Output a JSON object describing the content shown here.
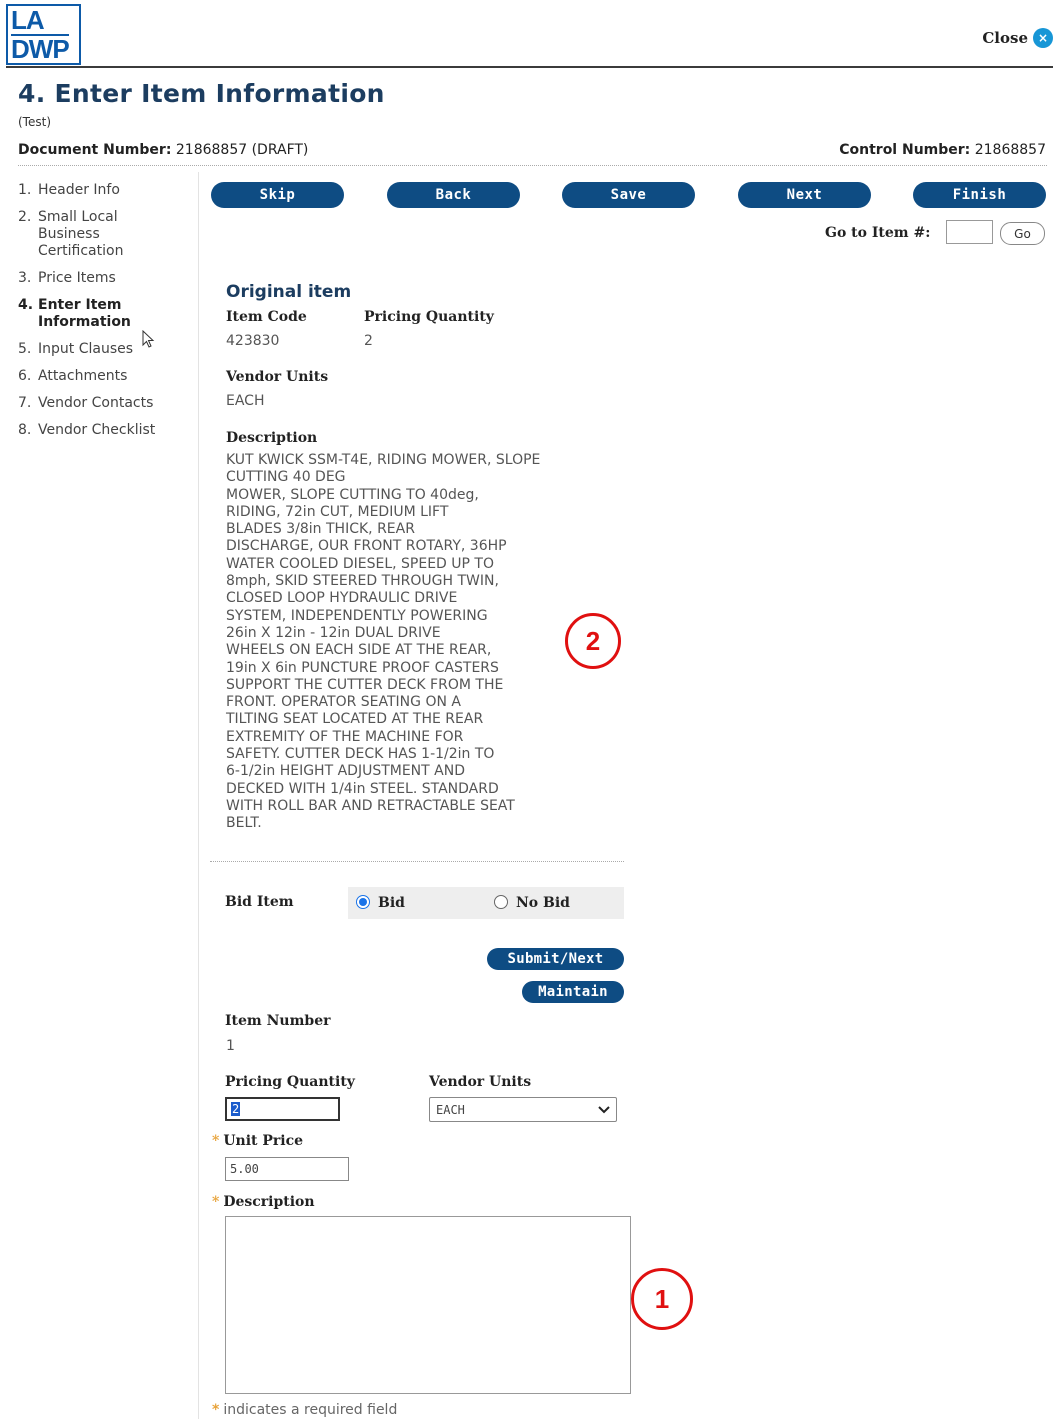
{
  "header": {
    "logo_line1": "LA",
    "logo_line2": "DWP",
    "close_label": "Close",
    "close_icon": "×"
  },
  "page": {
    "title": "4. Enter Item Information",
    "subtitle": "(Test)",
    "document_label": "Document Number:",
    "document_value": "21868857 (DRAFT)",
    "control_label": "Control Number:",
    "control_value": "21868857"
  },
  "sidebar": {
    "items": [
      {
        "num": "1.",
        "label": "Header Info"
      },
      {
        "num": "2.",
        "label": "Small Local Business Certification"
      },
      {
        "num": "3.",
        "label": "Price Items"
      },
      {
        "num": "4.",
        "label": "Enter Item Information"
      },
      {
        "num": "5.",
        "label": "Input Clauses"
      },
      {
        "num": "6.",
        "label": "Attachments"
      },
      {
        "num": "7.",
        "label": "Vendor Contacts"
      },
      {
        "num": "8.",
        "label": "Vendor Checklist"
      }
    ]
  },
  "toolbar": {
    "skip": "Skip",
    "back": "Back",
    "save": "Save",
    "next": "Next",
    "finish": "Finish",
    "goto_label": "Go to Item #:",
    "goto_value": "",
    "go": "Go"
  },
  "original": {
    "heading": "Original item",
    "item_code_label": "Item Code",
    "item_code": "423830",
    "pricing_qty_label": "Pricing Quantity",
    "pricing_qty": "2",
    "vendor_units_label": "Vendor Units",
    "vendor_units": "EACH",
    "description_label": "Description",
    "description_lines": [
      "KUT KWICK SSM-T4E, RIDING MOWER, SLOPE",
      "CUTTING 40 DEG",
      "MOWER, SLOPE CUTTING TO 40deg,",
      "RIDING, 72in CUT, MEDIUM LIFT",
      "BLADES 3/8in THICK, REAR",
      "DISCHARGE, OUR FRONT ROTARY, 36HP",
      "WATER COOLED DIESEL, SPEED UP TO",
      "8mph, SKID STEERED THROUGH TWIN,",
      "CLOSED LOOP HYDRAULIC DRIVE",
      "SYSTEM, INDEPENDENTLY POWERING",
      "26in X 12in - 12in DUAL DRIVE",
      "WHEELS ON EACH SIDE AT THE REAR,",
      "19in X 6in PUNCTURE PROOF CASTERS",
      "SUPPORT THE CUTTER DECK FROM THE",
      "FRONT. OPERATOR SEATING ON A",
      "TILTING SEAT LOCATED AT THE REAR",
      "EXTREMITY OF THE MACHINE FOR",
      "SAFETY. CUTTER DECK HAS 1-1/2in TO",
      "6-1/2in HEIGHT ADJUSTMENT AND",
      "DECKED WITH 1/4in STEEL. STANDARD",
      "WITH ROLL BAR AND RETRACTABLE SEAT",
      "BELT."
    ]
  },
  "annotations": {
    "marker_1": "1",
    "marker_2": "2"
  },
  "bid": {
    "label": "Bid Item",
    "option_bid": "Bid",
    "option_no_bid": "No Bid",
    "selected": "Bid",
    "submit_next": "Submit/Next",
    "maintain": "Maintain"
  },
  "form": {
    "item_number_label": "Item Number",
    "item_number": "1",
    "pricing_qty_label": "Pricing Quantity",
    "pricing_qty_value": "2",
    "vendor_units_label": "Vendor Units",
    "vendor_units_value": "EACH",
    "unit_price_label": "Unit Price",
    "unit_price_value": "5.00",
    "description_label": "Description",
    "description_value": "",
    "required_marker": "*",
    "required_note": "indicates a required field"
  },
  "colors": {
    "button_blue": "#0e4c83",
    "title_blue": "#1c3d60",
    "annotation_red": "#e01010",
    "required_orange": "#e8a33a",
    "close_icon_blue": "#1796d6"
  }
}
